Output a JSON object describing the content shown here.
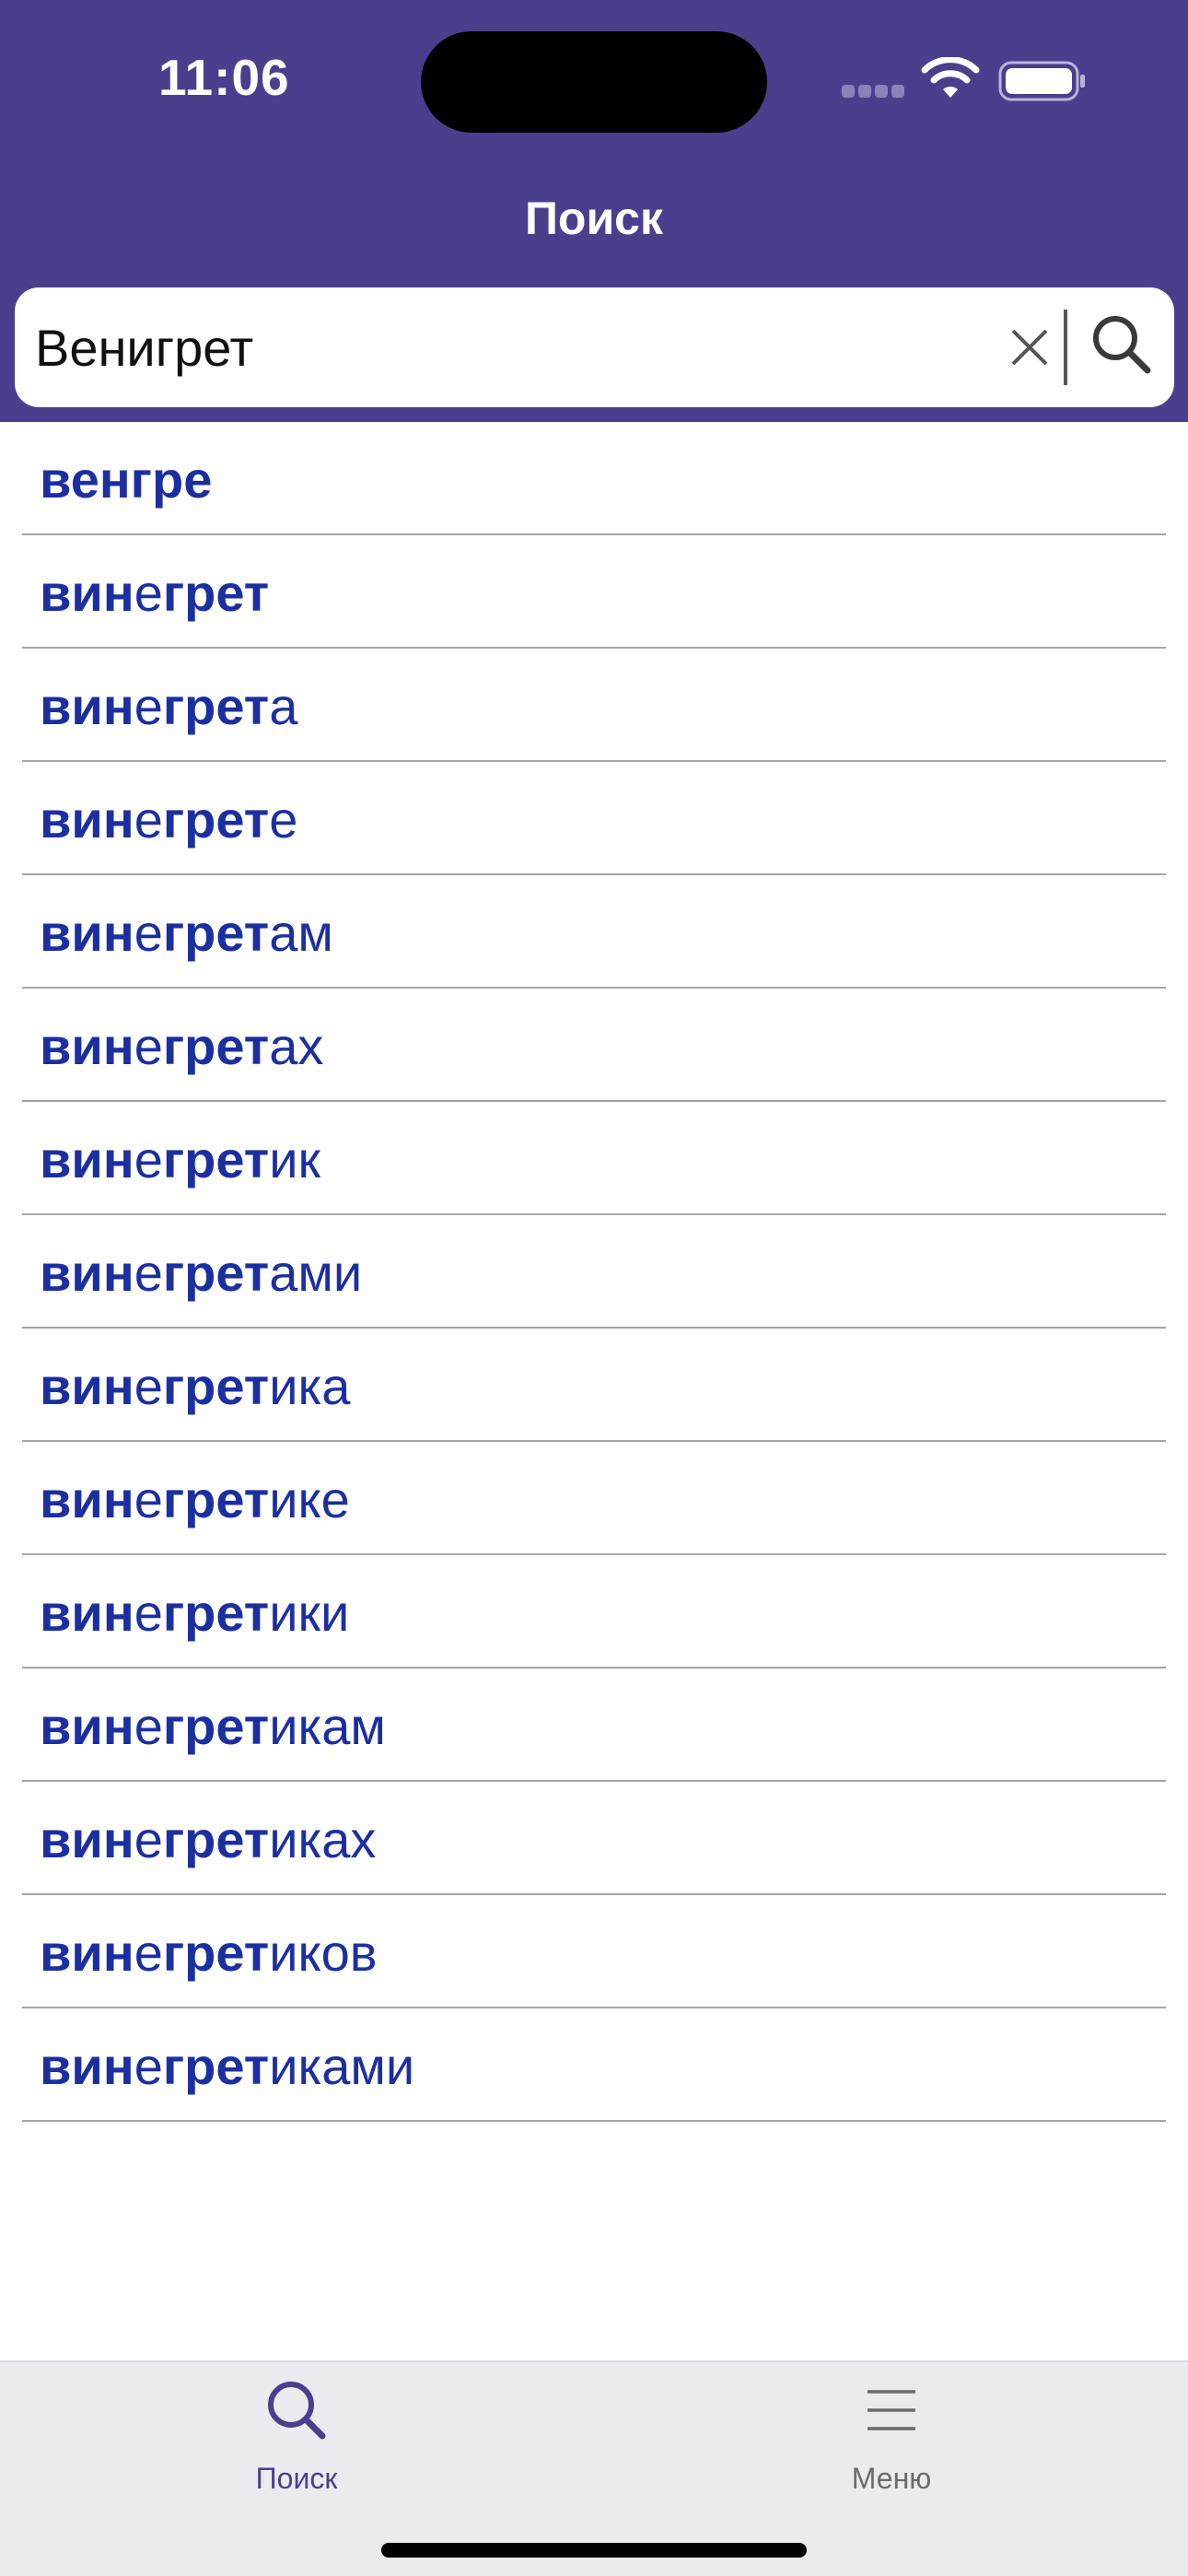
{
  "status_bar": {
    "time": "11:06"
  },
  "nav": {
    "title": "Поиск"
  },
  "search": {
    "value": "Венигрет"
  },
  "results": [
    {
      "bold1": "венгре",
      "normal1": "",
      "bold2": "",
      "normal2": ""
    },
    {
      "bold1": "ви",
      "normal1": "",
      "bold2": "нгрет",
      "normal2": ""
    },
    {
      "bold1": "ви",
      "normal1": "",
      "bold2": "н",
      "normal2": ""
    },
    {
      "bold1": "ви",
      "normal1": "",
      "bold2": "н",
      "normal2": ""
    },
    {
      "bold1": "ви",
      "normal1": "",
      "bold2": "н",
      "normal2": ""
    },
    {
      "bold1": "ви",
      "normal1": "",
      "bold2": "н",
      "normal2": ""
    },
    {
      "bold1": "ви",
      "normal1": "",
      "bold2": "н",
      "normal2": ""
    },
    {
      "bold1": "ви",
      "normal1": "",
      "bold2": "н",
      "normal2": ""
    },
    {
      "bold1": "ви",
      "normal1": "",
      "bold2": "н",
      "normal2": ""
    },
    {
      "bold1": "ви",
      "normal1": "",
      "bold2": "н",
      "normal2": ""
    },
    {
      "bold1": "ви",
      "normal1": "",
      "bold2": "н",
      "normal2": ""
    },
    {
      "bold1": "ви",
      "normal1": "",
      "bold2": "н",
      "normal2": ""
    },
    {
      "bold1": "ви",
      "normal1": "",
      "bold2": "н",
      "normal2": ""
    },
    {
      "bold1": "ви",
      "normal1": "",
      "bold2": "н",
      "normal2": ""
    },
    {
      "bold1": "ви",
      "normal1": "",
      "bold2": "н",
      "normal2": ""
    }
  ],
  "result_words": [
    [
      [
        "b",
        "венгре"
      ]
    ],
    [
      [
        "b",
        "ви"
      ],
      [
        "b",
        "н"
      ],
      [
        "s",
        "е"
      ],
      [
        "b",
        "грет"
      ]
    ],
    [
      [
        "b",
        "ви"
      ],
      [
        "b",
        "н"
      ],
      [
        "s",
        "е"
      ],
      [
        "b",
        "грет"
      ],
      [
        "s",
        "а"
      ]
    ],
    [
      [
        "b",
        "ви"
      ],
      [
        "b",
        "н"
      ],
      [
        "s",
        "е"
      ],
      [
        "b",
        "грет"
      ],
      [
        "s",
        "е"
      ]
    ],
    [
      [
        "b",
        "ви"
      ],
      [
        "b",
        "н"
      ],
      [
        "s",
        "е"
      ],
      [
        "b",
        "грет"
      ],
      [
        "s",
        "ам"
      ]
    ],
    [
      [
        "b",
        "ви"
      ],
      [
        "b",
        "н"
      ],
      [
        "s",
        "е"
      ],
      [
        "b",
        "грет"
      ],
      [
        "s",
        "ах"
      ]
    ],
    [
      [
        "b",
        "ви"
      ],
      [
        "b",
        "н"
      ],
      [
        "s",
        "е"
      ],
      [
        "b",
        "грет"
      ],
      [
        "s",
        "ик"
      ]
    ],
    [
      [
        "b",
        "ви"
      ],
      [
        "b",
        "н"
      ],
      [
        "s",
        "е"
      ],
      [
        "b",
        "грет"
      ],
      [
        "s",
        "ами"
      ]
    ],
    [
      [
        "b",
        "ви"
      ],
      [
        "b",
        "н"
      ],
      [
        "s",
        "е"
      ],
      [
        "b",
        "грет"
      ],
      [
        "s",
        "ика"
      ]
    ],
    [
      [
        "b",
        "ви"
      ],
      [
        "b",
        "н"
      ],
      [
        "s",
        "е"
      ],
      [
        "b",
        "грет"
      ],
      [
        "s",
        "ике"
      ]
    ],
    [
      [
        "b",
        "ви"
      ],
      [
        "b",
        "н"
      ],
      [
        "s",
        "е"
      ],
      [
        "b",
        "грет"
      ],
      [
        "s",
        "ики"
      ]
    ],
    [
      [
        "b",
        "ви"
      ],
      [
        "b",
        "н"
      ],
      [
        "s",
        "е"
      ],
      [
        "b",
        "грет"
      ],
      [
        "s",
        "икам"
      ]
    ],
    [
      [
        "b",
        "ви"
      ],
      [
        "b",
        "н"
      ],
      [
        "s",
        "е"
      ],
      [
        "b",
        "грет"
      ],
      [
        "s",
        "иках"
      ]
    ],
    [
      [
        "b",
        "ви"
      ],
      [
        "b",
        "н"
      ],
      [
        "s",
        "е"
      ],
      [
        "b",
        "грет"
      ],
      [
        "s",
        "иков"
      ]
    ],
    [
      [
        "b",
        "ви"
      ],
      [
        "b",
        "н"
      ],
      [
        "s",
        "е"
      ],
      [
        "b",
        "грет"
      ],
      [
        "s",
        "иками"
      ]
    ]
  ],
  "tab_bar": {
    "tabs": [
      {
        "label": "Поиск",
        "icon": "search-icon",
        "active": true
      },
      {
        "label": "Меню",
        "icon": "menu-icon",
        "active": false
      }
    ]
  },
  "colors": {
    "header": "#4a3f8c",
    "result_text": "#1c2fa0",
    "active_tab": "#4a3f8c",
    "inactive_tab": "#6b6b6b"
  }
}
